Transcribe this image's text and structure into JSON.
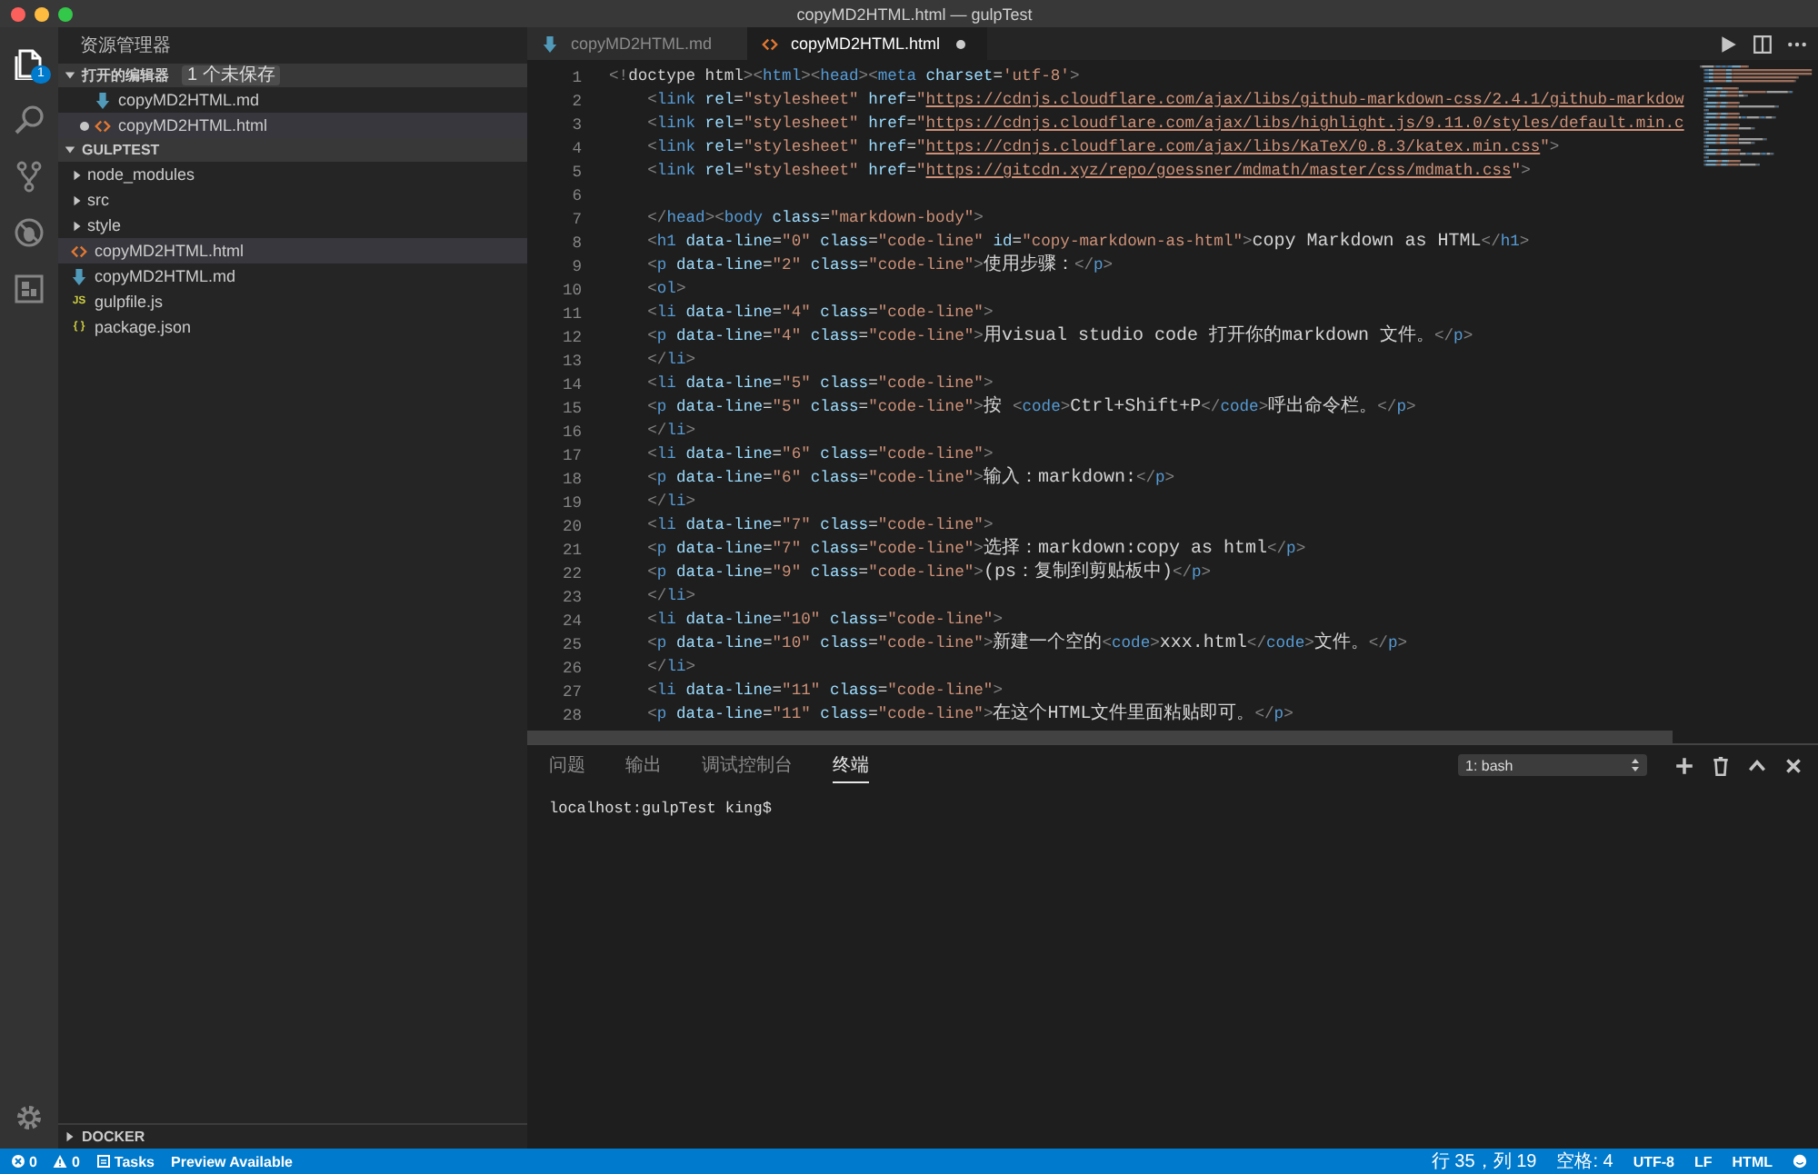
{
  "window": {
    "title": "copyMD2HTML.html — gulpTest"
  },
  "activity_bar": {
    "items": [
      {
        "kind": "files",
        "selected": true,
        "badge": "1"
      },
      {
        "kind": "search",
        "selected": false
      },
      {
        "kind": "scm",
        "selected": false
      },
      {
        "kind": "debug",
        "selected": false
      },
      {
        "kind": "extensions",
        "selected": false
      }
    ],
    "bottom": {
      "kind": "settings"
    }
  },
  "sidebar": {
    "title": "资源管理器",
    "sections": [
      {
        "title": "打开的编辑器",
        "expanded": true,
        "badge": "1 个未保存",
        "kind": "open",
        "items": [
          {
            "label": "copyMD2HTML.md",
            "kind": "md",
            "dirty": false,
            "selected": false
          },
          {
            "label": "copyMD2HTML.html",
            "kind": "html",
            "dirty": true,
            "selected": true
          }
        ]
      },
      {
        "title": "GULPTEST",
        "expanded": true,
        "kind": "tree",
        "items": [
          {
            "label": "node_modules",
            "kind": "folder",
            "expanded": false,
            "selected": false
          },
          {
            "label": "src",
            "kind": "folder",
            "expanded": false,
            "selected": false
          },
          {
            "label": "style",
            "kind": "folder",
            "expanded": false,
            "selected": false
          },
          {
            "label": "copyMD2HTML.html",
            "kind": "html",
            "selected": true
          },
          {
            "label": "copyMD2HTML.md",
            "kind": "md",
            "selected": false
          },
          {
            "label": "gulpfile.js",
            "kind": "js",
            "icon_text": "JS",
            "selected": false
          },
          {
            "label": "package.json",
            "kind": "json",
            "icon_text": "{ }",
            "selected": false
          }
        ]
      },
      {
        "title": "DOCKER",
        "expanded": false,
        "kind": "bottom"
      }
    ]
  },
  "editor": {
    "tabs": [
      {
        "label": "copyMD2HTML.md",
        "kind": "md",
        "selected": false,
        "dirty": false
      },
      {
        "label": "copyMD2HTML.html",
        "kind": "html",
        "selected": true,
        "dirty": true
      }
    ],
    "lines": [
      {
        "number": "1",
        "text": "<!doctype html><html><head><meta charset='utf-8'>"
      },
      {
        "number": "2",
        "text": "    <link rel=\"stylesheet\" href=\"https://cdnjs.cloudflare.com/ajax/libs/github-markdown-css/2.4.1/github-markdow"
      },
      {
        "number": "3",
        "text": "    <link rel=\"stylesheet\" href=\"https://cdnjs.cloudflare.com/ajax/libs/highlight.js/9.11.0/styles/default.min.c"
      },
      {
        "number": "4",
        "text": "    <link rel=\"stylesheet\" href=\"https://cdnjs.cloudflare.com/ajax/libs/KaTeX/0.8.3/katex.min.css\">"
      },
      {
        "number": "5",
        "text": "    <link rel=\"stylesheet\" href=\"https://gitcdn.xyz/repo/goessner/mdmath/master/css/mdmath.css\">"
      },
      {
        "number": "6"
      },
      {
        "number": "7",
        "text": "    </head><body class=\"markdown-body\">"
      },
      {
        "number": "8",
        "text": "    <h1 data-line=\"0\" class=\"code-line\" id=\"copy-markdown-as-html\">copy Markdown as HTML</h1>"
      },
      {
        "number": "9",
        "text": "    <p data-line=\"2\" class=\"code-line\">使用步骤：</p>"
      },
      {
        "number": "10",
        "text": "    <ol>"
      },
      {
        "number": "11",
        "text": "    <li data-line=\"4\" class=\"code-line\">"
      },
      {
        "number": "12",
        "text": "    <p data-line=\"4\" class=\"code-line\">用visual studio code 打开你的markdown 文件。</p>"
      },
      {
        "number": "13",
        "text": "    </li>"
      },
      {
        "number": "14",
        "text": "    <li data-line=\"5\" class=\"code-line\">"
      },
      {
        "number": "15",
        "text": "    <p data-line=\"5\" class=\"code-line\">按 <code>Ctrl+Shift+P</code>呼出命令栏。</p>"
      },
      {
        "number": "16",
        "text": "    </li>"
      },
      {
        "number": "17",
        "text": "    <li data-line=\"6\" class=\"code-line\">"
      },
      {
        "number": "18",
        "text": "    <p data-line=\"6\" class=\"code-line\">输入：markdown:</p>"
      },
      {
        "number": "19",
        "text": "    </li>"
      },
      {
        "number": "20",
        "text": "    <li data-line=\"7\" class=\"code-line\">"
      },
      {
        "number": "21",
        "text": "    <p data-line=\"7\" class=\"code-line\">选择：markdown:copy as html</p>"
      },
      {
        "number": "22",
        "text": "    <p data-line=\"9\" class=\"code-line\">(ps：复制到剪贴板中)</p>"
      },
      {
        "number": "23",
        "text": "    </li>"
      },
      {
        "number": "24",
        "text": "    <li data-line=\"10\" class=\"code-line\">"
      },
      {
        "number": "25",
        "text": "    <p data-line=\"10\" class=\"code-line\">新建一个空的<code>xxx.html</code>文件。</p>"
      },
      {
        "number": "26",
        "text": "    </li>"
      },
      {
        "number": "27",
        "text": "    <li data-line=\"11\" class=\"code-line\">"
      },
      {
        "number": "28",
        "text": "    <p data-line=\"11\" class=\"code-line\">在这个HTML文件里面粘贴即可。</p>"
      }
    ]
  },
  "panel": {
    "tabs": [
      {
        "label": "问题",
        "selected": false
      },
      {
        "label": "输出",
        "selected": false
      },
      {
        "label": "调试控制台",
        "selected": false
      },
      {
        "label": "终端",
        "selected": true
      }
    ],
    "terminal_selector": "1: bash",
    "terminal_lines": [
      "localhost:gulpTest king$"
    ]
  },
  "status_bar": {
    "left": [
      {
        "kind": "errors",
        "text": "0"
      },
      {
        "kind": "warnings",
        "text": "0"
      },
      {
        "kind": "tasks",
        "text": "Tasks"
      },
      {
        "kind": "plain",
        "text": "Preview Available"
      }
    ],
    "right": [
      {
        "kind": "plain",
        "text": "行 35，列 19"
      },
      {
        "kind": "plain",
        "text": "空格: 4"
      },
      {
        "kind": "plain",
        "text": "UTF-8"
      },
      {
        "kind": "plain",
        "text": "LF"
      },
      {
        "kind": "plain",
        "text": "HTML"
      },
      {
        "kind": "feedback"
      }
    ]
  }
}
